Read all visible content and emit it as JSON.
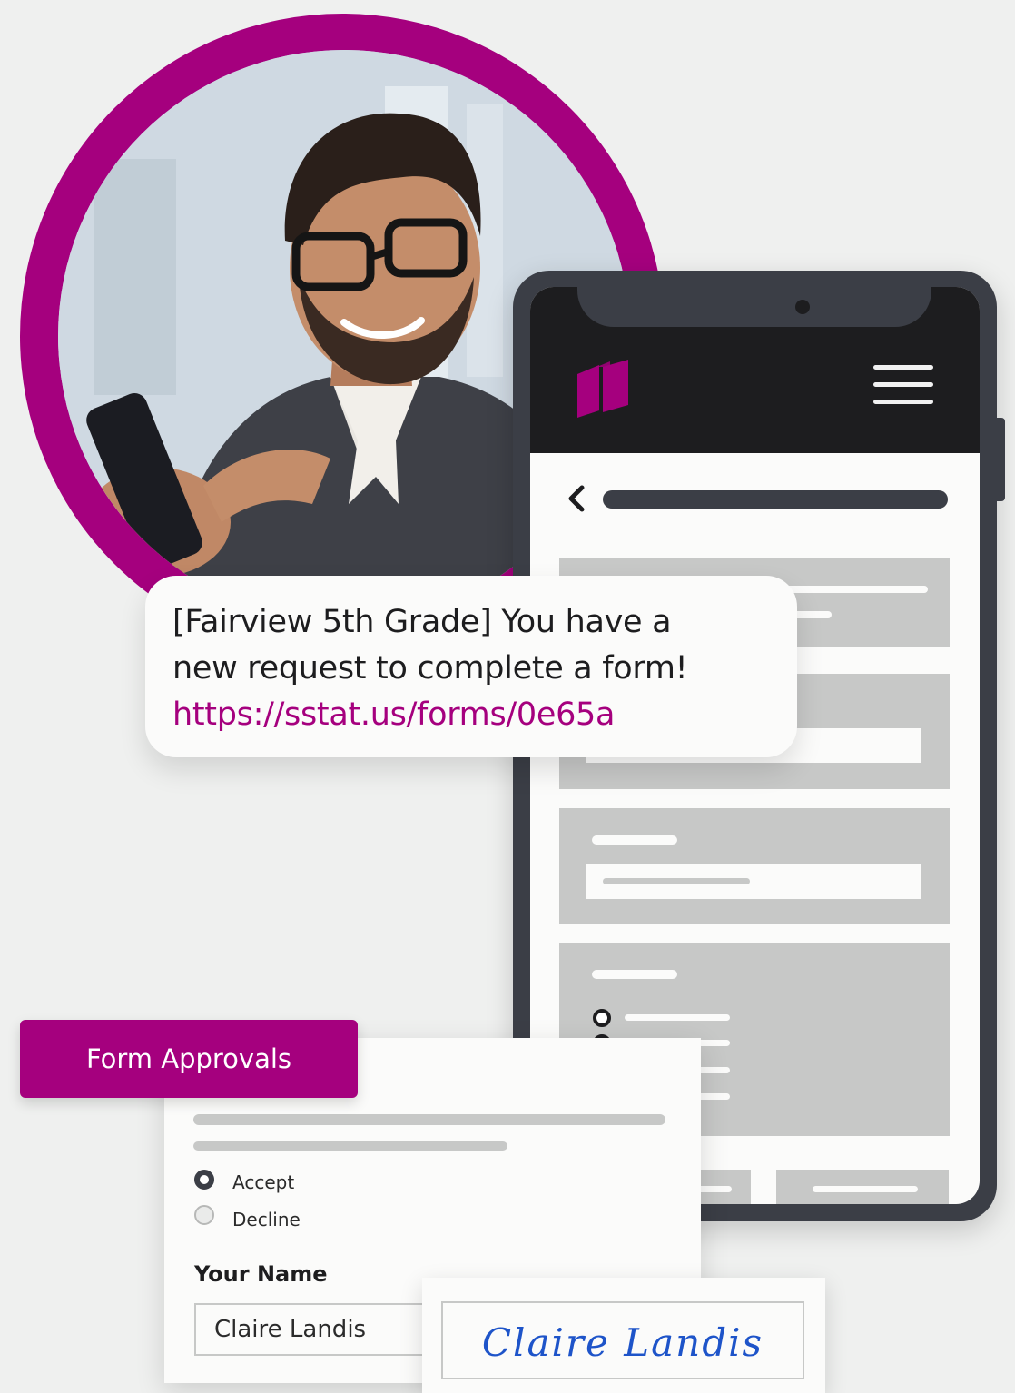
{
  "sms": {
    "line1": "[Fairview 5th Grade] You have a",
    "line2": "new request to complete a form!",
    "link": "https://sstat.us/forms/0e65a"
  },
  "form": {
    "badge": "Form Approvals",
    "options": [
      {
        "label": "Accept",
        "selected": true
      },
      {
        "label": "Decline",
        "selected": false
      }
    ],
    "name_label": "Your Name",
    "name_value": "Claire Landis"
  },
  "signature": {
    "text": "Claire Landis"
  },
  "colors": {
    "brand": "#a5007e",
    "dark": "#1d1d1f",
    "phone_frame": "#3b3e46",
    "placeholder_gray": "#c7c8c7",
    "signature_ink": "#1e54c9"
  },
  "icons": {
    "logo": "book-logo-icon",
    "menu": "hamburger-menu-icon",
    "back": "chevron-left-icon"
  }
}
